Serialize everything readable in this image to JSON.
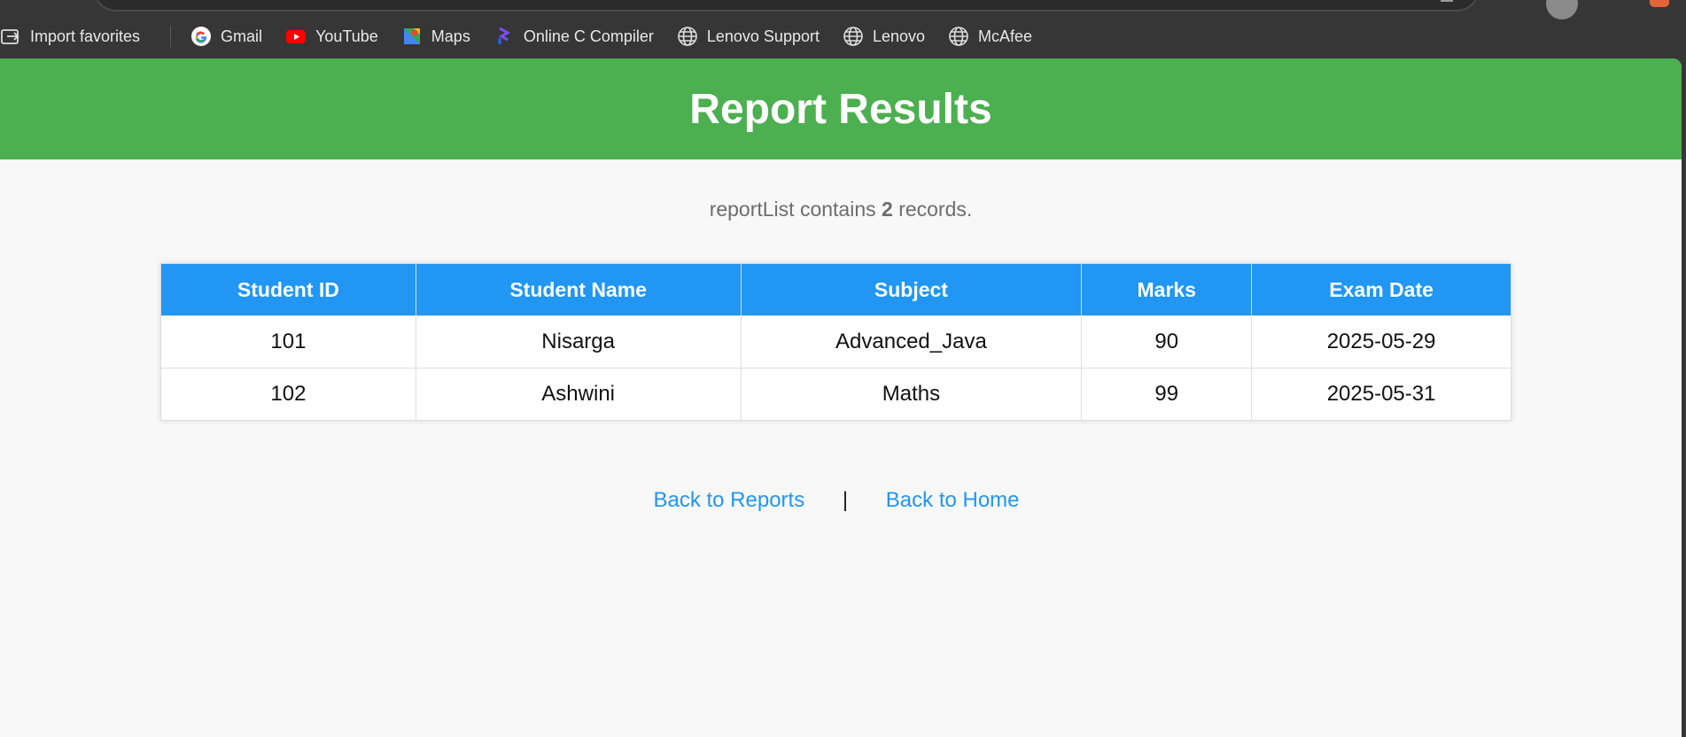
{
  "bookmarks": [
    {
      "label": "Import favorites",
      "icon": "import-icon"
    },
    {
      "label": "Gmail",
      "icon": "google-icon"
    },
    {
      "label": "YouTube",
      "icon": "youtube-icon"
    },
    {
      "label": "Maps",
      "icon": "maps-icon"
    },
    {
      "label": "Online C Compiler",
      "icon": "compiler-icon"
    },
    {
      "label": "Lenovo Support",
      "icon": "globe-icon"
    },
    {
      "label": "Lenovo",
      "icon": "globe-icon"
    },
    {
      "label": "McAfee",
      "icon": "globe-icon"
    }
  ],
  "header": {
    "title": "Report Results",
    "color": "#4caf50"
  },
  "summary": {
    "prefix": "reportList contains",
    "count": "2",
    "suffix": "records."
  },
  "table": {
    "columns": [
      "Student ID",
      "Student Name",
      "Subject",
      "Marks",
      "Exam Date"
    ],
    "rows": [
      [
        "101",
        "Nisarga",
        "Advanced_Java",
        "90",
        "2025-05-29"
      ],
      [
        "102",
        "Ashwini",
        "Maths",
        "99",
        "2025-05-31"
      ]
    ],
    "header_color": "#2196f3"
  },
  "links": {
    "back_reports": "Back to Reports",
    "separator": "|",
    "back_home": "Back to Home"
  }
}
